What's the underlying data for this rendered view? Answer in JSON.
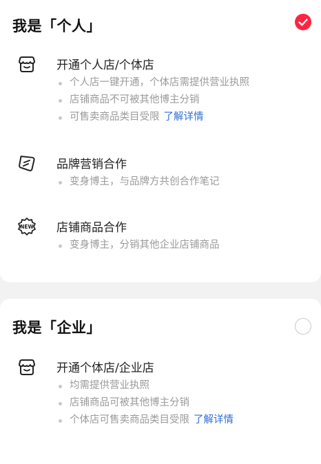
{
  "personal": {
    "title": "我是「个人」",
    "selected": true,
    "features": [
      {
        "icon": "store-icon",
        "title": "开通个人店/个体店",
        "bullets": [
          {
            "text": "个人店一键开通，个体店需提供营业执照"
          },
          {
            "text": "店铺商品不可被其他博主分销"
          },
          {
            "text": "可售卖商品类目受限",
            "link": "了解详情"
          }
        ]
      },
      {
        "icon": "brand-tag-icon",
        "title": "品牌营销合作",
        "bullets": [
          {
            "text": "变身博主，与品牌方共创合作笔记"
          }
        ]
      },
      {
        "icon": "new-badge-icon",
        "icon_text": "NEW",
        "title": "店铺商品合作",
        "bullets": [
          {
            "text": "变身博主，分销其他企业店铺商品"
          }
        ]
      }
    ]
  },
  "enterprise": {
    "title": "我是「企业」",
    "selected": false,
    "features": [
      {
        "icon": "store-icon",
        "title": "开通个体店/企业店",
        "bullets": [
          {
            "text": "均需提供营业执照"
          },
          {
            "text": "店铺商品可被其他博主分销"
          },
          {
            "text": "个体店可售卖商品类目受限",
            "link": "了解详情"
          }
        ]
      }
    ]
  },
  "colors": {
    "accent": "#ff2442",
    "link": "#2f6fd6",
    "muted": "#9a9a9a",
    "background": "#f2f2f2"
  }
}
